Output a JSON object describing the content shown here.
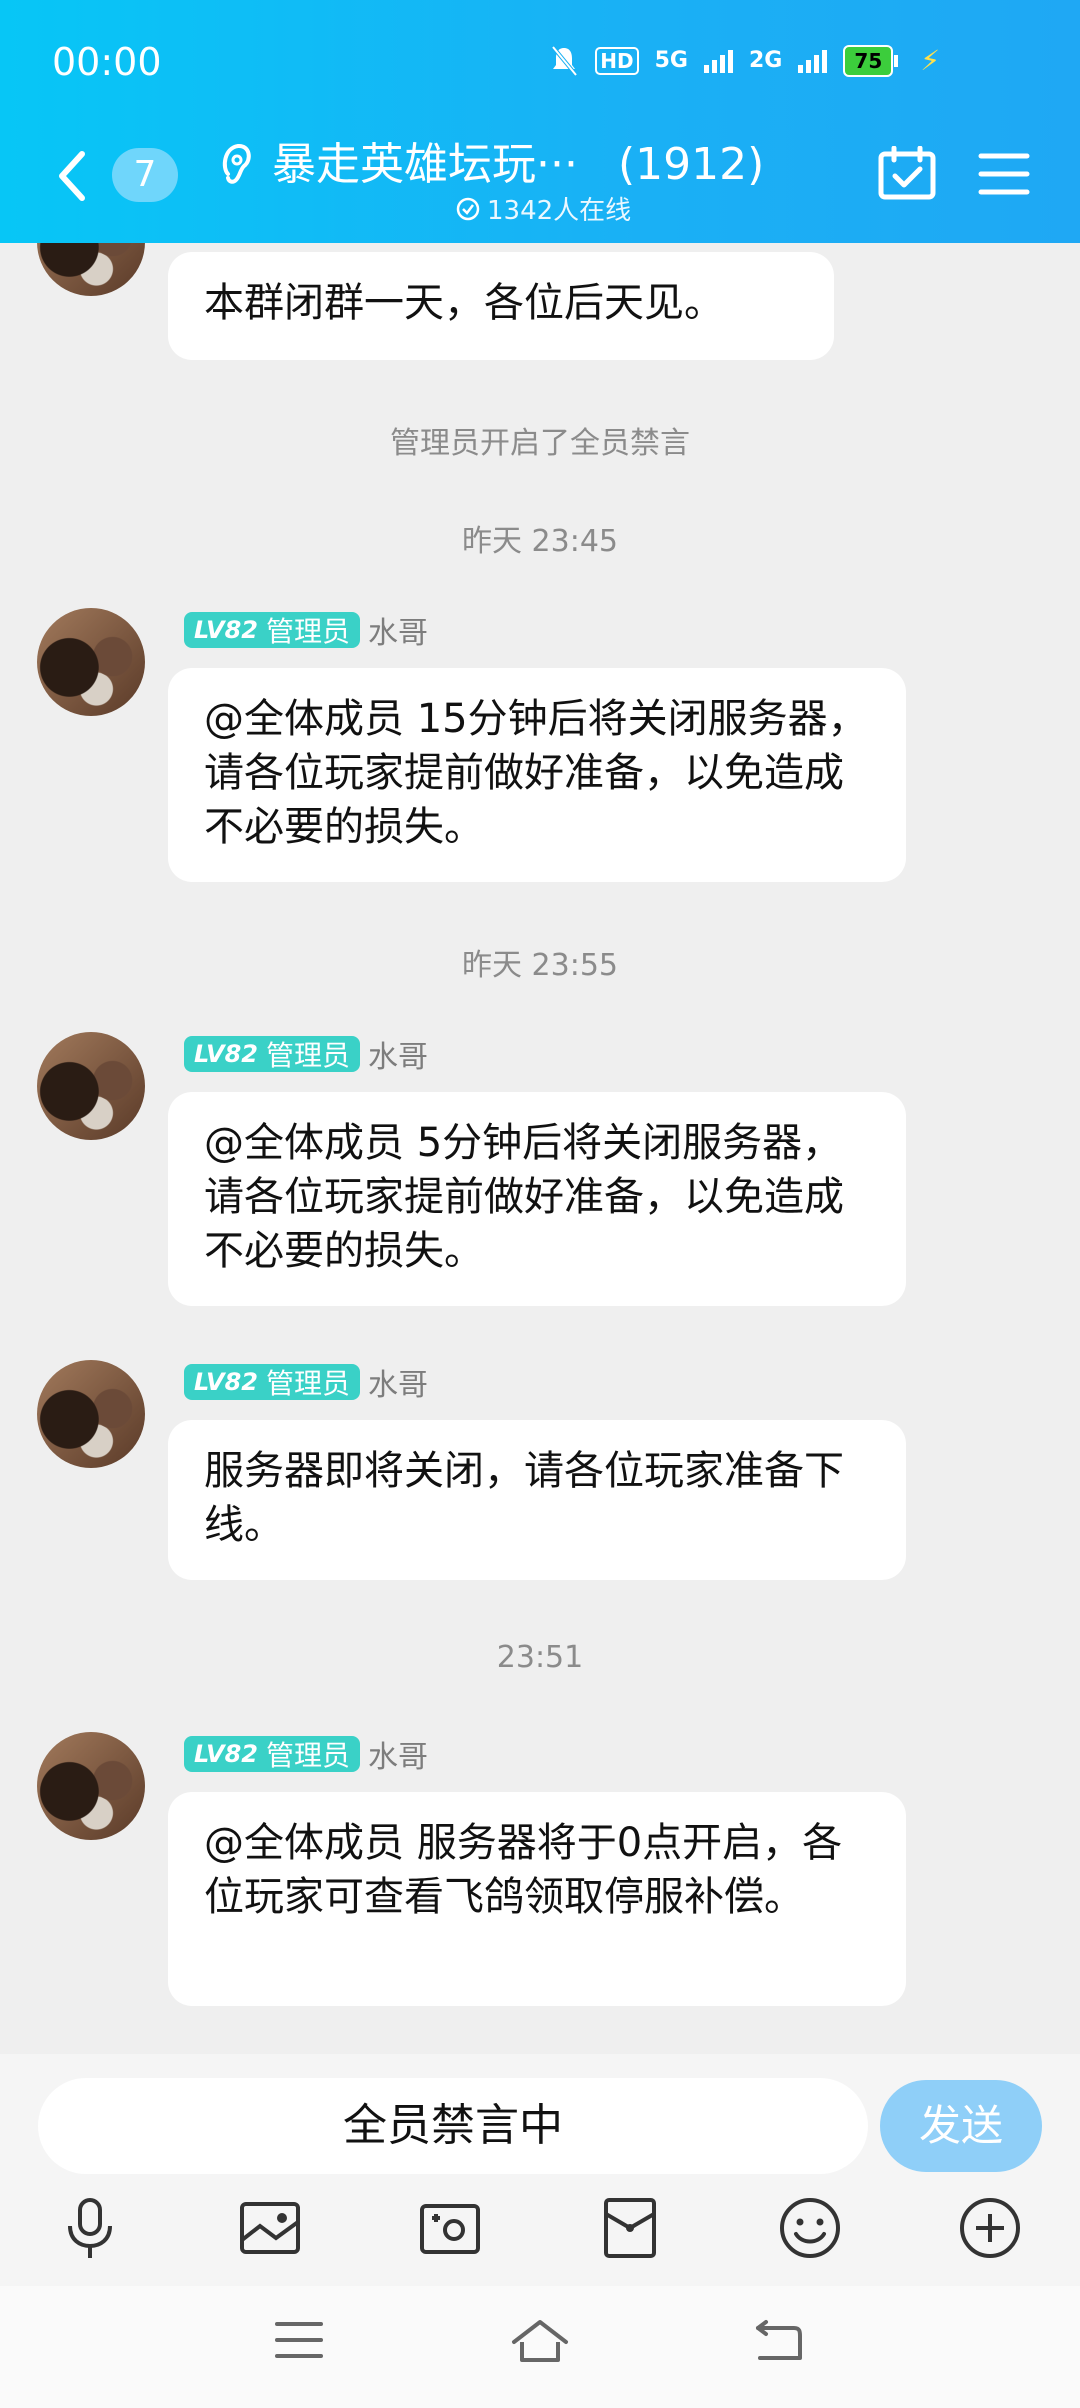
{
  "status_bar": {
    "time": "00:00",
    "hd": "HD",
    "sim1_label": "5G",
    "sim2_label": "2G",
    "battery": "75"
  },
  "header": {
    "unread_count": "7",
    "group_name": "暴走英雄坛玩···",
    "member_count": "(1912)",
    "online": "1342人在线"
  },
  "messages": {
    "m0_text": "本群闭群一天，各位后天见。",
    "sys1": "管理员开启了全员禁言",
    "time1": "昨天 23:45",
    "m1_level": "LV82",
    "m1_role": "管理员",
    "m1_name": "水哥",
    "m1_text": "@全体成员 15分钟后将关闭服务器，请各位玩家提前做好准备，以免造成不必要的损失。",
    "time2": "昨天 23:55",
    "m2_level": "LV82",
    "m2_role": "管理员",
    "m2_name": "水哥",
    "m2_text": "@全体成员 5分钟后将关闭服务器，请各位玩家提前做好准备，以免造成不必要的损失。",
    "m3_level": "LV82",
    "m3_role": "管理员",
    "m3_name": "水哥",
    "m3_text": "服务器即将关闭，请各位玩家准备下线。",
    "time3": "23:51",
    "m4_level": "LV82",
    "m4_role": "管理员",
    "m4_name": "水哥",
    "m4_text": "@全体成员 服务器将于0点开启，各位玩家可查看飞鸽领取停服补偿。"
  },
  "input": {
    "placeholder": "全员禁言中",
    "send_label": "发送"
  },
  "toolbar_icons": [
    "microphone-icon",
    "image-icon",
    "camera-icon",
    "red-packet-icon",
    "emoji-icon",
    "plus-icon"
  ],
  "nav_icons": [
    "menu-icon",
    "home-icon",
    "back-icon"
  ],
  "colors": {
    "header_start": "#07c6f6",
    "header_end": "#1fa8f4",
    "badge_bg": "#6fd6fb",
    "level_tag": "#3ad1c7",
    "send_button": "#8fcff8",
    "battery": "#3ccd3c"
  }
}
